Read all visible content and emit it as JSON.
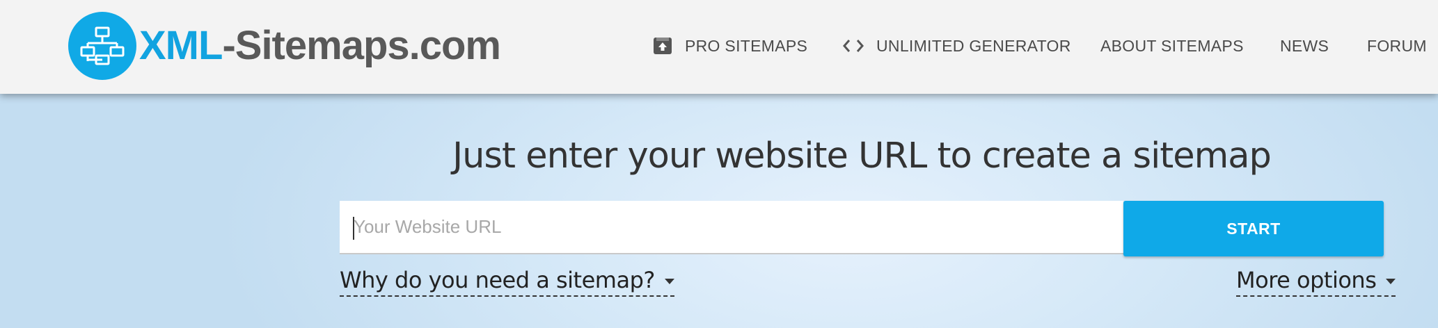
{
  "header": {
    "logo": {
      "brand_primary": "XML",
      "brand_secondary": "-Sitemaps.com",
      "icon": "sitemap-icon",
      "brand_color": "#10a9e6"
    },
    "nav": [
      {
        "label": "PRO SITEMAPS",
        "icon": "pro-sitemaps-icon"
      },
      {
        "label": "UNLIMITED GENERATOR",
        "icon": "code-icon"
      },
      {
        "label": "ABOUT SITEMAPS"
      },
      {
        "label": "NEWS"
      },
      {
        "label": "FORUM"
      }
    ]
  },
  "main": {
    "headline": "Just enter your website URL to create a sitemap",
    "url_input": {
      "value": "",
      "placeholder": "Your Website URL"
    },
    "start_button": {
      "label": "START",
      "color": "#0fa9e8"
    },
    "why_link": "Why do you need a sitemap?",
    "more_options_link": "More options"
  }
}
